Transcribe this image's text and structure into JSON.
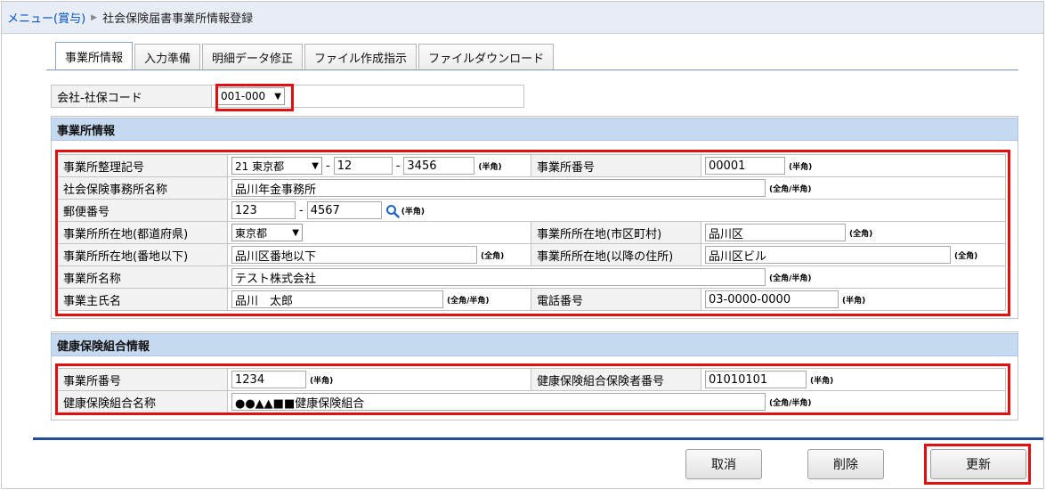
{
  "breadcrumb": {
    "parent": "メニュー(賞与)",
    "current": "社会保険届書事業所情報登録"
  },
  "tabs": [
    {
      "label": "事業所情報",
      "active": true
    },
    {
      "label": "入力準備",
      "active": false
    },
    {
      "label": "明細データ修正",
      "active": false
    },
    {
      "label": "ファイル作成指示",
      "active": false
    },
    {
      "label": "ファイルダウンロード",
      "active": false
    }
  ],
  "company": {
    "label": "会社-社保コード",
    "value": "001-000"
  },
  "office_section": {
    "title": "事業所情報",
    "reg_symbol_label": "事業所整理記号",
    "reg_pref": "21 東京都",
    "reg_code1": "12",
    "reg_code2": "3456",
    "reg_note": "(半角)",
    "office_no_label": "事業所番号",
    "office_no": "00001",
    "office_no_note": "(半角)",
    "pension_office_label": "社会保険事務所名称",
    "pension_office": "品川年金事務所",
    "pension_office_note": "(全角/半角)",
    "postal_label": "郵便番号",
    "postal1": "123",
    "postal2": "4567",
    "postal_note": "(半角)",
    "prefecture_label": "事業所所在地(都道府県)",
    "prefecture": "東京都",
    "city_label": "事業所所在地(市区町村)",
    "city": "品川区",
    "city_note": "(全角)",
    "address_label": "事業所所在地(番地以下)",
    "address": "品川区番地以下",
    "address_note": "(全角)",
    "address2_label": "事業所所在地(以降の住所)",
    "address2": "品川区ビル",
    "address2_note": "(全角)",
    "office_name_label": "事業所名称",
    "office_name": "テスト株式会社",
    "office_name_note": "(全角/半角)",
    "owner_label": "事業主氏名",
    "owner": "品川　太郎",
    "owner_note": "(全角/半角)",
    "phone_label": "電話番号",
    "phone": "03-0000-0000",
    "phone_note": "(半角)"
  },
  "health_section": {
    "title": "健康保険組合情報",
    "office_no_label": "事業所番号",
    "office_no": "1234",
    "office_no_note": "(半角)",
    "insurer_no_label": "健康保険組合保険者番号",
    "insurer_no": "01010101",
    "insurer_no_note": "(半角)",
    "union_name_label": "健康保険組合名称",
    "union_name": "●●▲▲■■健康保険組合",
    "union_name_note": "(全角/半角)"
  },
  "buttons": {
    "cancel": "取消",
    "delete": "削除",
    "update": "更新"
  },
  "colors": {
    "section_header": "#c5d9f1",
    "highlight": "#e01010",
    "link": "#0050c8",
    "bottom_rule": "#1f4e96"
  }
}
